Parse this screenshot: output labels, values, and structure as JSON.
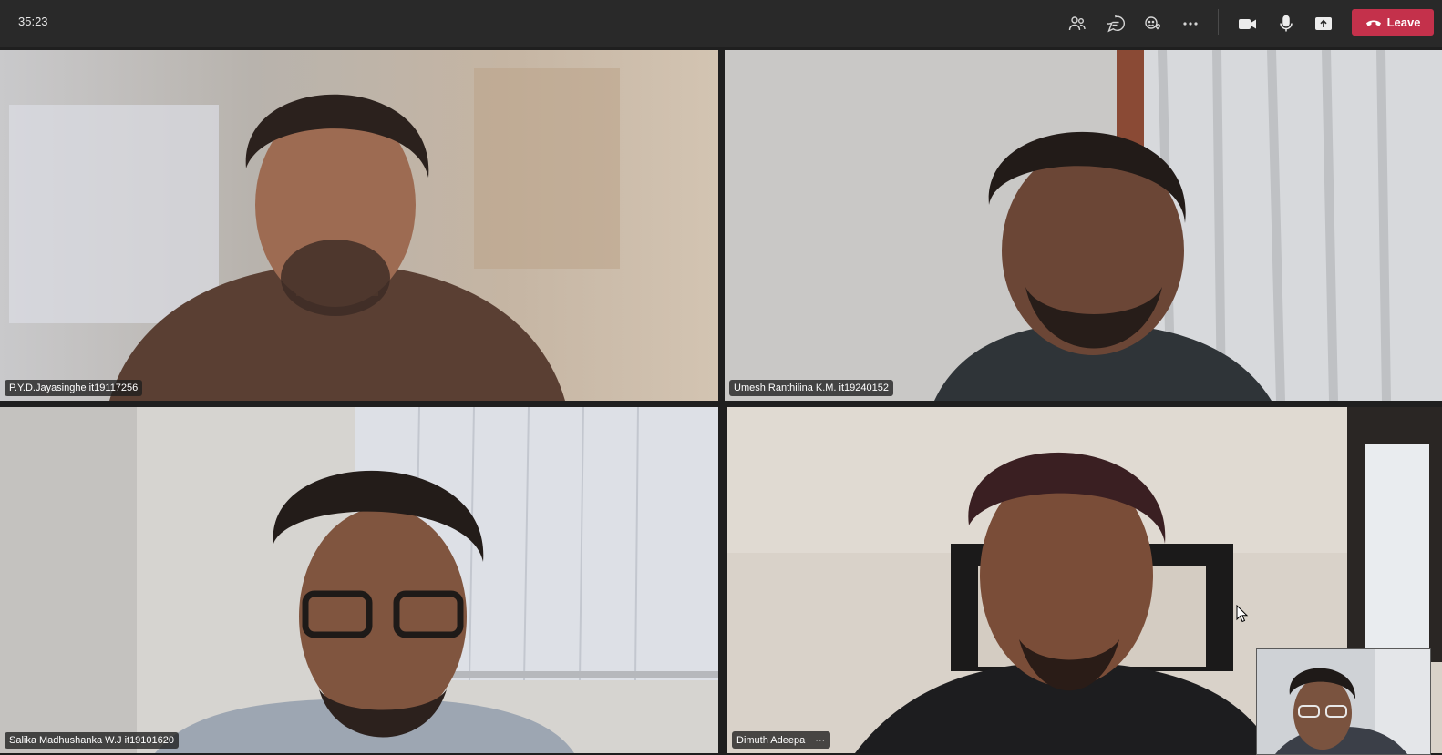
{
  "timer": "35:23",
  "toolbar": {
    "icons": [
      "people-icon",
      "chat-icon",
      "reactions-icon",
      "more-icon",
      "camera-icon",
      "mic-icon",
      "share-icon"
    ],
    "leave_label": "Leave",
    "leave_color": "#c4314b"
  },
  "participants": [
    {
      "name": "P.Y.D.Jayasinghe it19117256"
    },
    {
      "name": "Umesh Ranthilina K.M. it19240152"
    },
    {
      "name": "Salika Madhushanka W.J it19101620"
    },
    {
      "name": "Dimuth Adeepa"
    }
  ],
  "accent_color": "#7f85f5"
}
